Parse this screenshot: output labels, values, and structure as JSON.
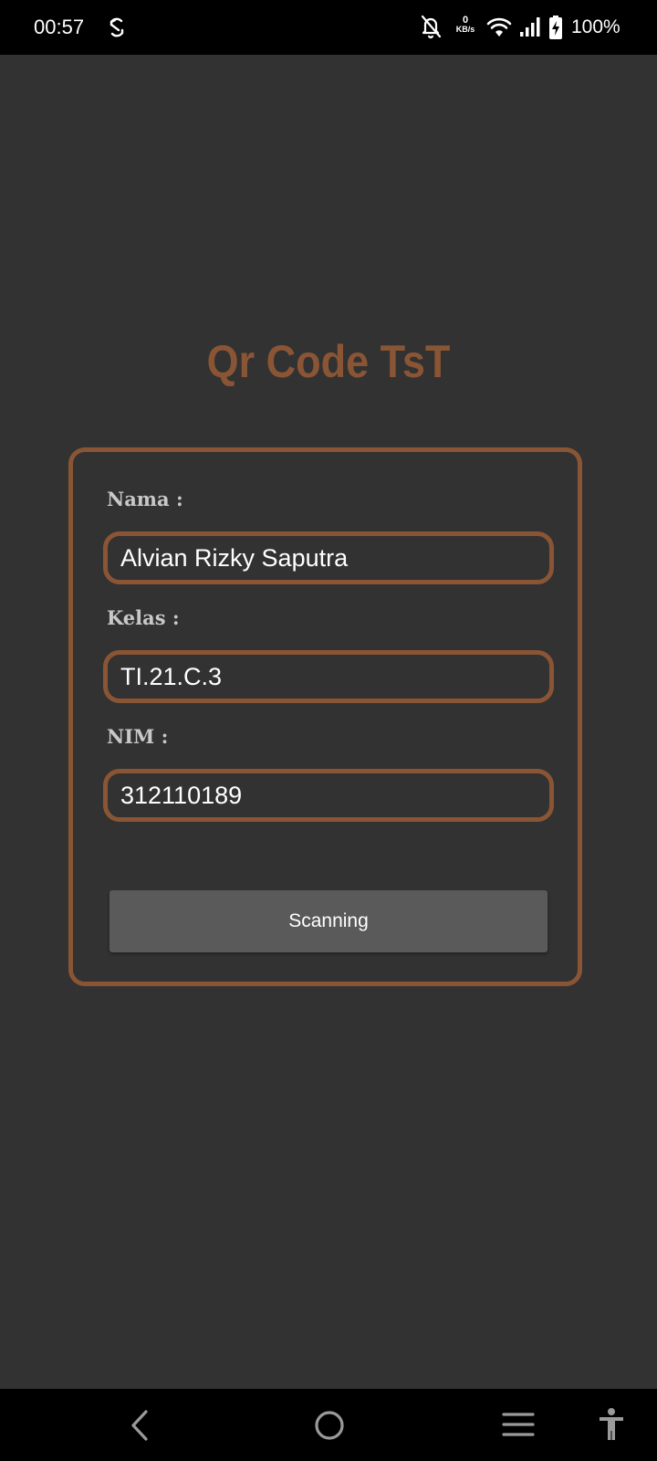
{
  "status_bar": {
    "time": "00:57",
    "net_speed_value": "0",
    "net_speed_unit": "KB/s",
    "battery_percent": "100%",
    "icons": [
      "sync-icon",
      "bell-off-icon",
      "wifi-icon",
      "signal-icon",
      "battery-charging-icon"
    ]
  },
  "app": {
    "title": "Qr Code TsT"
  },
  "form": {
    "nama_label": "Nama :",
    "nama_value": "Alvian Rizky Saputra",
    "kelas_label": "Kelas :",
    "kelas_value": "TI.21.C.3",
    "nim_label": "NIM :",
    "nim_value": "312110189",
    "scan_button_label": "Scanning"
  },
  "nav_bar": {
    "icons": [
      "back-icon",
      "home-icon",
      "recents-icon",
      "accessibility-icon"
    ]
  },
  "colors": {
    "background": "#323232",
    "accent": "#8a5535",
    "button": "#5a5a5a",
    "label": "#c8c8c8"
  }
}
